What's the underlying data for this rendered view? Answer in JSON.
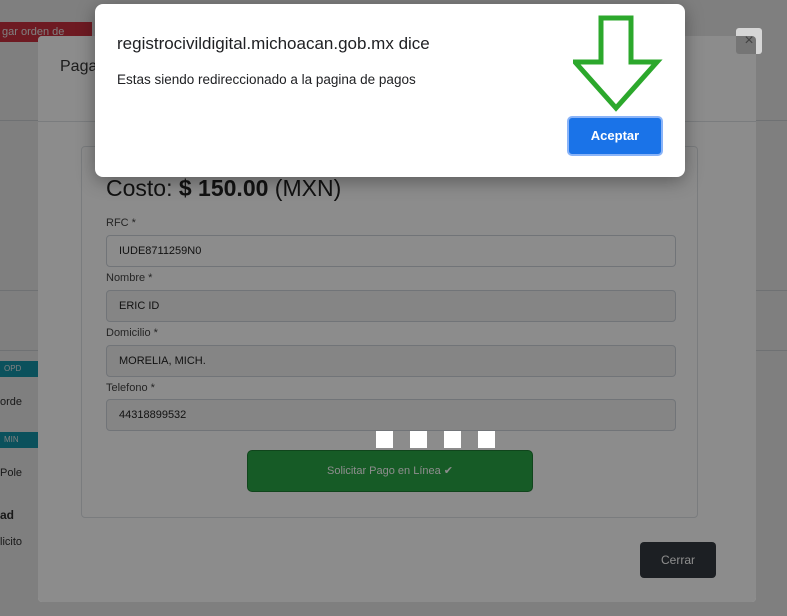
{
  "background": {
    "red_button_label": "gar orden de",
    "teal_badge_1": "OPD",
    "teal_badge_2": "MIN",
    "row_text_1": "orde",
    "row_text_2": "Pole",
    "section_label": "ad",
    "section_sub": "licito"
  },
  "modal": {
    "title": "Paga",
    "close_icon": "×",
    "costo_label": "Costo:",
    "costo_amount": "$ 150.00",
    "costo_currency": "(MXN)",
    "fields": [
      {
        "label": "RFC *",
        "value": "IUDE8711259N0"
      },
      {
        "label": "Nombre *",
        "value": "ERIC ID"
      },
      {
        "label": "Domicilio *",
        "value": "MORELIA, MICH."
      },
      {
        "label": "Telefono *",
        "value": "44318899532"
      }
    ],
    "pay_button": "Solicitar Pago en Línea ✔",
    "close_button": "Cerrar"
  },
  "alert": {
    "origin": "registrocivildigital.michoacan.gob.mx dice",
    "message": "Estas siendo redireccionado a la pagina de pagos",
    "ok_button": "Aceptar"
  },
  "colors": {
    "accent_blue": "#1a73e8",
    "arrow_green": "#2ca82c",
    "pay_green": "#28a745",
    "danger_red": "#dc3545"
  }
}
